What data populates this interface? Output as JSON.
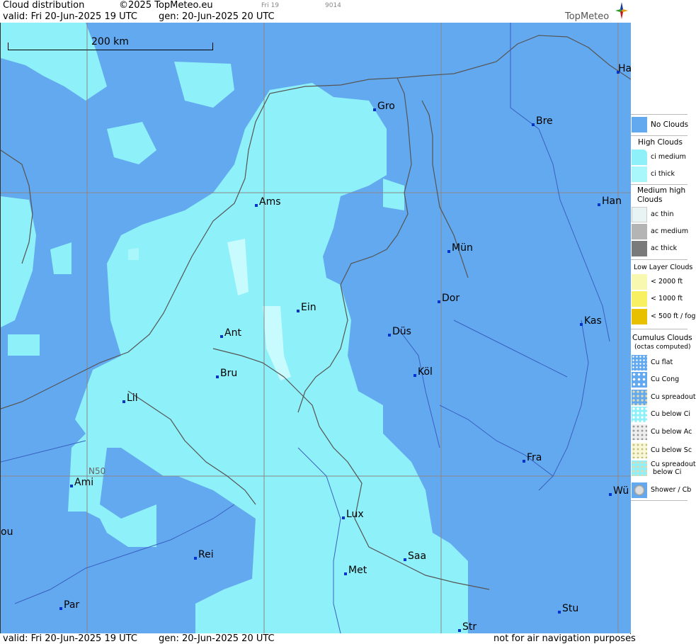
{
  "header": {
    "title": "Cloud distribution",
    "copyright": "©2025 TopMeteo.eu",
    "valid": "valid:  Fri  20-Jun-2025  19 UTC",
    "generated": "gen: 20-Jun-2025 20 UTC",
    "frame_label": "Fri 19",
    "frame_code": "9014",
    "logo": "TopMeteo"
  },
  "map": {
    "scale_label": "200 km",
    "latitude_label": "N50",
    "cities": [
      {
        "id": "ha",
        "label": "Ha"
      },
      {
        "id": "gro",
        "label": "Gro"
      },
      {
        "id": "bre",
        "label": "Bre"
      },
      {
        "id": "ams",
        "label": "Ams"
      },
      {
        "id": "han",
        "label": "Han"
      },
      {
        "id": "mun",
        "label": "Mün"
      },
      {
        "id": "dor",
        "label": "Dor"
      },
      {
        "id": "ein",
        "label": "Ein"
      },
      {
        "id": "kas",
        "label": "Kas"
      },
      {
        "id": "ant",
        "label": "Ant"
      },
      {
        "id": "dus",
        "label": "Düs"
      },
      {
        "id": "bru",
        "label": "Bru"
      },
      {
        "id": "kol",
        "label": "Köl"
      },
      {
        "id": "lil",
        "label": "Lil"
      },
      {
        "id": "fra",
        "label": "Fra"
      },
      {
        "id": "ami",
        "label": "Ami"
      },
      {
        "id": "wu",
        "label": "Wü"
      },
      {
        "id": "lux",
        "label": "Lux"
      },
      {
        "id": "ou",
        "label": "ou"
      },
      {
        "id": "rei",
        "label": "Rei"
      },
      {
        "id": "saa",
        "label": "Saa"
      },
      {
        "id": "met",
        "label": "Met"
      },
      {
        "id": "par",
        "label": "Par"
      },
      {
        "id": "stu",
        "label": "Stu"
      },
      {
        "id": "str",
        "label": "Str"
      }
    ]
  },
  "footer": {
    "valid": "valid:  Fri  20-Jun-2025  19 UTC",
    "generated": "gen: 20-Jun-2025 20 UTC",
    "disclaimer": "not for air navigation purposes"
  },
  "legend": {
    "no_clouds": "No Clouds",
    "high_head": "High Clouds",
    "ci_medium": "ci medium",
    "ci_thick": "ci thick",
    "medium_head_1": "Medium high",
    "medium_head_2": "Clouds",
    "ac_thin": "ac thin",
    "ac_medium": "ac medium",
    "ac_thick": "ac thick",
    "low_head": "Low Layer Clouds",
    "low_2000": "< 2000 ft",
    "low_1000": "< 1000 ft",
    "low_500": "< 500 ft / fog",
    "cu_head_1": "Cumulus Clouds",
    "cu_head_2": "(octas computed)",
    "cu_flat": "Cu flat",
    "cu_cong": "Cu Cong",
    "cu_spreadout": "Cu spreadout",
    "cu_below_ci": "Cu below Ci",
    "cu_below_ac": "Cu below Ac",
    "cu_below_sc": "Cu below Sc",
    "cu_spread_ci_1": "Cu spreadout",
    "cu_spread_ci_2": "below Ci",
    "shower": "Shower / Cb",
    "colors": {
      "no_clouds": "#63a9ef",
      "ci_medium": "#8ef0f8",
      "ci_thick": "#aaf7fb",
      "ac_thin": "#e8f4f4",
      "ac_medium": "#b4b4b4",
      "ac_thick": "#7a7a7a",
      "low_2000": "#f8f8b0",
      "low_1000": "#f8f060",
      "low_500": "#e8c000"
    }
  }
}
